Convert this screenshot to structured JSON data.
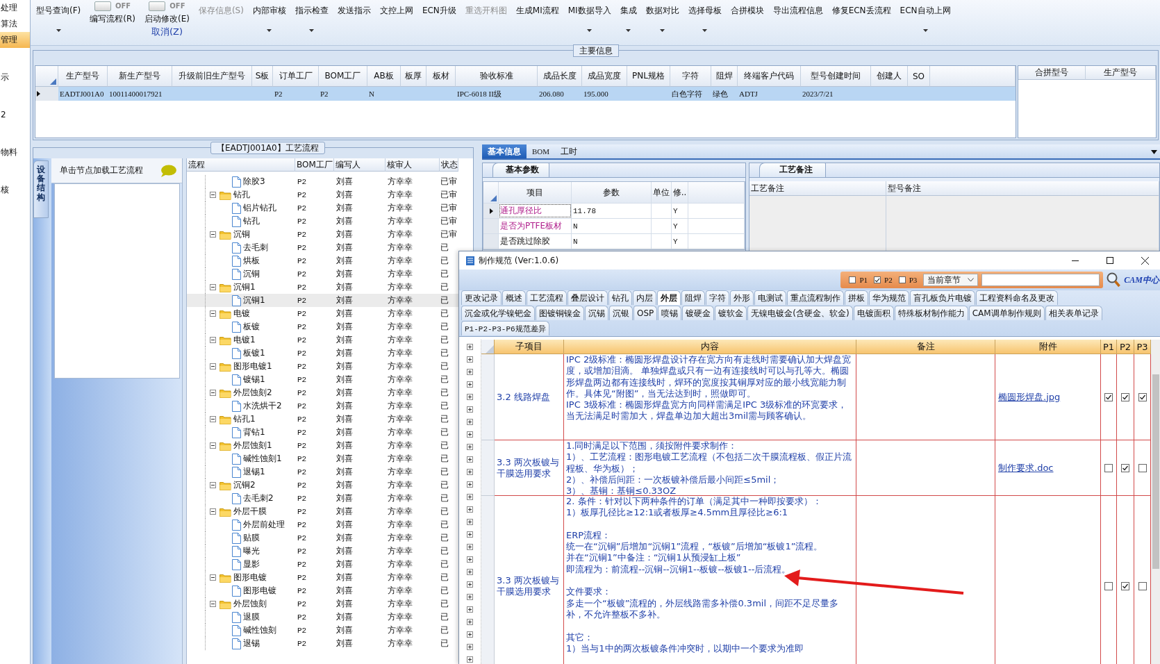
{
  "sidebar": {
    "items": [
      {
        "label": "处理",
        "selected": false
      },
      {
        "label": "算法",
        "selected": false
      },
      {
        "label": "管理",
        "selected": true
      },
      {
        "label": "示",
        "selected": false
      },
      {
        "label": "2",
        "selected": false
      },
      {
        "label": "物料",
        "selected": false
      },
      {
        "label": "核",
        "selected": false
      }
    ]
  },
  "toolbar": {
    "items": [
      {
        "kind": "button",
        "label": "型号查询(F)",
        "dropdown": true,
        "disabled": false
      },
      {
        "kind": "switch",
        "label": "编写流程(R)",
        "switch_text": "OFF",
        "on": false
      },
      {
        "kind": "switch",
        "label": "启动修改(E)",
        "sublabel": "取消(Z)",
        "switch_text": "OFF",
        "on": false
      },
      {
        "kind": "button",
        "label": "保存信息(S)",
        "dropdown": false,
        "disabled": true
      },
      {
        "kind": "button",
        "label": "内部审核",
        "dropdown": true,
        "disabled": false
      },
      {
        "kind": "button",
        "label": "指示检查",
        "dropdown": true,
        "disabled": false
      },
      {
        "kind": "button",
        "label": "发送指示",
        "dropdown": false,
        "disabled": false
      },
      {
        "kind": "button",
        "label": "文控上网",
        "dropdown": false,
        "disabled": false
      },
      {
        "kind": "button",
        "label": "ECN升级",
        "dropdown": false,
        "disabled": false
      },
      {
        "kind": "button",
        "label": "重选开料图",
        "dropdown": false,
        "disabled": true
      },
      {
        "kind": "button",
        "label": "生成MI流程",
        "dropdown": false,
        "disabled": false
      },
      {
        "kind": "button",
        "label": "MI数据导入",
        "dropdown": true,
        "disabled": false
      },
      {
        "kind": "button",
        "label": "集成",
        "dropdown": true,
        "disabled": false
      },
      {
        "kind": "button",
        "label": "数据对比",
        "dropdown": true,
        "disabled": false
      },
      {
        "kind": "button",
        "label": "选择母板",
        "dropdown": true,
        "disabled": false
      },
      {
        "kind": "button",
        "label": "合拼模块",
        "dropdown": false,
        "disabled": false
      },
      {
        "kind": "button",
        "label": "导出流程信息",
        "dropdown": false,
        "disabled": false
      },
      {
        "kind": "button",
        "label": "修复ECN丢流程",
        "dropdown": false,
        "disabled": false
      },
      {
        "kind": "button",
        "label": "ECN自动上网",
        "dropdown": true,
        "disabled": false
      }
    ]
  },
  "main_info": {
    "title": "主要信息",
    "table": {
      "columns": [
        "生产型号",
        "新生产型号",
        "升级前旧生产型号",
        "S板",
        "订单工厂",
        "BOM工厂",
        "AB板",
        "板厚",
        "板材",
        "验收标准",
        "成品长度",
        "成品宽度",
        "PNL规格",
        "字符",
        "阻焊",
        "终端客户代码",
        "型号创建时间",
        "创建人",
        "SO"
      ],
      "rows": [
        {
          "selected": true,
          "cells": [
            "EADTJ001A0",
            "10011400017921",
            null,
            null,
            "P2",
            "P2",
            "N",
            null,
            null,
            "IPC-6018 II级",
            "206.080",
            "195.000",
            null,
            "白色字符",
            "绿色",
            "ADTJ",
            "2023/7/21",
            null,
            null
          ]
        }
      ]
    },
    "merge_table": {
      "columns": [
        "合拼型号",
        "生产型号"
      ]
    }
  },
  "flow": {
    "title": "【EADTJ001A0】工艺流程",
    "side_tab": {
      "label": "设备结构",
      "selected": true
    },
    "hint": "单击节点加载工艺流程",
    "columns": [
      "流程",
      "BOM工厂",
      "编写人",
      "核审人",
      "状态"
    ],
    "rows": [
      {
        "kind": "doc",
        "label": "除胶3",
        "selected": false,
        "bom": "P2",
        "author": "刘喜",
        "reviewer": "方幸幸",
        "status": "已审"
      },
      {
        "kind": "folder",
        "label": "钻孔",
        "expanded": true,
        "selected": false,
        "bom": "P2",
        "author": "刘喜",
        "reviewer": "方幸幸",
        "status": "已审",
        "children": [
          {
            "kind": "doc",
            "label": "铝片钻孔",
            "selected": false,
            "bom": "P2",
            "author": "刘喜",
            "reviewer": "方幸幸",
            "status": "已审"
          },
          {
            "kind": "doc",
            "label": "钻孔",
            "selected": false,
            "bom": "P2",
            "author": "刘喜",
            "reviewer": "方幸幸",
            "status": "已审"
          }
        ]
      },
      {
        "kind": "folder",
        "label": "沉铜",
        "expanded": true,
        "selected": false,
        "bom": "P2",
        "author": "刘喜",
        "reviewer": "方幸幸",
        "status": "已审",
        "children": [
          {
            "kind": "doc",
            "label": "去毛刺",
            "selected": false,
            "bom": "P2",
            "author": "刘喜",
            "reviewer": "方幸幸",
            "status": "已"
          },
          {
            "kind": "doc",
            "label": "烘板",
            "selected": false,
            "bom": "P2",
            "author": "刘喜",
            "reviewer": "方幸幸",
            "status": "已"
          },
          {
            "kind": "doc",
            "label": "沉铜",
            "selected": false,
            "bom": "P2",
            "author": "刘喜",
            "reviewer": "方幸幸",
            "status": "已"
          }
        ]
      },
      {
        "kind": "folder",
        "label": "沉铜1",
        "expanded": true,
        "selected": false,
        "bom": "P2",
        "author": "刘喜",
        "reviewer": "方幸幸",
        "status": "已",
        "children": [
          {
            "kind": "doc",
            "label": "沉铜1",
            "selected": true,
            "bom": "P2",
            "author": "刘喜",
            "reviewer": "方幸幸",
            "status": "已"
          }
        ]
      },
      {
        "kind": "folder",
        "label": "电镀",
        "expanded": true,
        "selected": false,
        "bom": "P2",
        "author": "刘喜",
        "reviewer": "方幸幸",
        "status": "已",
        "children": [
          {
            "kind": "doc",
            "label": "板镀",
            "selected": false,
            "bom": "P2",
            "author": "刘喜",
            "reviewer": "方幸幸",
            "status": "已"
          }
        ]
      },
      {
        "kind": "folder",
        "label": "电镀1",
        "expanded": true,
        "selected": false,
        "bom": "P2",
        "author": "刘喜",
        "reviewer": "方幸幸",
        "status": "已",
        "children": [
          {
            "kind": "doc",
            "label": "板镀1",
            "selected": false,
            "bom": "P2",
            "author": "刘喜",
            "reviewer": "方幸幸",
            "status": "已"
          }
        ]
      },
      {
        "kind": "folder",
        "label": "图形电镀1",
        "expanded": true,
        "selected": false,
        "bom": "P2",
        "author": "刘喜",
        "reviewer": "方幸幸",
        "status": "已",
        "children": [
          {
            "kind": "doc",
            "label": "镀锡1",
            "selected": false,
            "bom": "P2",
            "author": "刘喜",
            "reviewer": "方幸幸",
            "status": "已"
          }
        ]
      },
      {
        "kind": "folder",
        "label": "外层蚀刻2",
        "expanded": true,
        "selected": false,
        "bom": "P2",
        "author": "刘喜",
        "reviewer": "方幸幸",
        "status": "已",
        "children": [
          {
            "kind": "doc",
            "label": "水洗烘干2",
            "selected": false,
            "bom": "P2",
            "author": "刘喜",
            "reviewer": "方幸幸",
            "status": "已"
          }
        ]
      },
      {
        "kind": "folder",
        "label": "钻孔1",
        "expanded": true,
        "selected": false,
        "bom": "P2",
        "author": "刘喜",
        "reviewer": "方幸幸",
        "status": "已",
        "children": [
          {
            "kind": "doc",
            "label": "背钻1",
            "selected": false,
            "bom": "P2",
            "author": "刘喜",
            "reviewer": "方幸幸",
            "status": "已"
          }
        ]
      },
      {
        "kind": "folder",
        "label": "外层蚀刻1",
        "expanded": true,
        "selected": false,
        "bom": "P2",
        "author": "刘喜",
        "reviewer": "方幸幸",
        "status": "已",
        "children": [
          {
            "kind": "doc",
            "label": "碱性蚀刻1",
            "selected": false,
            "bom": "P2",
            "author": "刘喜",
            "reviewer": "方幸幸",
            "status": "已"
          },
          {
            "kind": "doc",
            "label": "退锡1",
            "selected": false,
            "bom": "P2",
            "author": "刘喜",
            "reviewer": "方幸幸",
            "status": "已"
          }
        ]
      },
      {
        "kind": "folder",
        "label": "沉铜2",
        "expanded": true,
        "selected": false,
        "bom": "P2",
        "author": "刘喜",
        "reviewer": "方幸幸",
        "status": "已",
        "children": [
          {
            "kind": "doc",
            "label": "去毛刺2",
            "selected": false,
            "bom": "P2",
            "author": "刘喜",
            "reviewer": "方幸幸",
            "status": "已"
          }
        ]
      },
      {
        "kind": "folder",
        "label": "外层干膜",
        "expanded": true,
        "selected": false,
        "bom": "P2",
        "author": "刘喜",
        "reviewer": "方幸幸",
        "status": "已",
        "children": [
          {
            "kind": "doc",
            "label": "外层前处理",
            "selected": false,
            "bom": "P2",
            "author": "刘喜",
            "reviewer": "方幸幸",
            "status": "已"
          },
          {
            "kind": "doc",
            "label": "贴膜",
            "selected": false,
            "bom": "P2",
            "author": "刘喜",
            "reviewer": "方幸幸",
            "status": "已"
          },
          {
            "kind": "doc",
            "label": "曝光",
            "selected": false,
            "bom": "P2",
            "author": "刘喜",
            "reviewer": "方幸幸",
            "status": "已"
          },
          {
            "kind": "doc",
            "label": "显影",
            "selected": false,
            "bom": "P2",
            "author": "刘喜",
            "reviewer": "方幸幸",
            "status": "已"
          }
        ]
      },
      {
        "kind": "folder",
        "label": "图形电镀",
        "expanded": true,
        "selected": false,
        "bom": "P2",
        "author": "刘喜",
        "reviewer": "方幸幸",
        "status": "已",
        "children": [
          {
            "kind": "doc",
            "label": "图形电镀",
            "selected": false,
            "bom": "P2",
            "author": "刘喜",
            "reviewer": "方幸幸",
            "status": "已"
          }
        ]
      },
      {
        "kind": "folder",
        "label": "外层蚀刻",
        "expanded": true,
        "selected": false,
        "bom": "P2",
        "author": "刘喜",
        "reviewer": "方幸幸",
        "status": "已",
        "children": [
          {
            "kind": "doc",
            "label": "退膜",
            "selected": false,
            "bom": "P2",
            "author": "刘喜",
            "reviewer": "方幸幸",
            "status": "已"
          },
          {
            "kind": "doc",
            "label": "碱性蚀刻",
            "selected": false,
            "bom": "P2",
            "author": "刘喜",
            "reviewer": "方幸幸",
            "status": "已"
          },
          {
            "kind": "doc",
            "label": "退锡",
            "selected": false,
            "bom": "P2",
            "author": "刘喜",
            "reviewer": "方幸幸",
            "status": "已"
          }
        ]
      }
    ]
  },
  "detail": {
    "tabs": [
      {
        "label": "基本信息",
        "selected": true
      },
      {
        "label": "BOM",
        "selected": false
      },
      {
        "label": "工时",
        "selected": false
      }
    ],
    "params": {
      "tab": "基本参数",
      "columns": [
        "项目",
        "参数",
        "单位",
        "修.."
      ],
      "rows": [
        {
          "item": "通孔厚径比",
          "value": "11.78",
          "flag": "Y",
          "highlight": true,
          "selected": true
        },
        {
          "item": "是否为PTFE板材",
          "value": "N",
          "flag": "Y",
          "highlight": true,
          "selected": false
        },
        {
          "item": "是否跳过除胶",
          "value": "N",
          "flag": "Y",
          "highlight": false,
          "selected": false
        }
      ]
    },
    "notes": {
      "tab": "工艺备注",
      "columns": [
        "工艺备注",
        "型号备注"
      ]
    }
  },
  "dialog": {
    "title": "制作规范 (Ver:1.0.6)",
    "filters": [
      {
        "label": "P1",
        "checked": false
      },
      {
        "label": "P2",
        "checked": true
      },
      {
        "label": "P3",
        "checked": false
      }
    ],
    "scope": "当前章节",
    "logo": "CAM中心",
    "tab_rows": [
      [
        {
          "label": "更改记录",
          "selected": false
        },
        {
          "label": "概述",
          "selected": false
        },
        {
          "label": "工艺流程",
          "selected": false
        },
        {
          "label": "叠层设计",
          "selected": false
        },
        {
          "label": "钻孔",
          "selected": false
        },
        {
          "label": "内层",
          "selected": false
        },
        {
          "label": "外层",
          "selected": true
        },
        {
          "label": "阻焊",
          "selected": false
        },
        {
          "label": "字符",
          "selected": false
        },
        {
          "label": "外形",
          "selected": false
        },
        {
          "label": "电测试",
          "selected": false
        },
        {
          "label": "重点流程制作",
          "selected": false
        },
        {
          "label": "拼板",
          "selected": false
        },
        {
          "label": "华为规范",
          "selected": false
        },
        {
          "label": "盲孔板负片电镀",
          "selected": false
        },
        {
          "label": "工程资料命名及更改",
          "selected": false
        }
      ],
      [
        {
          "label": "沉金或化学镍钯金",
          "selected": false
        },
        {
          "label": "图镀铜镍金",
          "selected": false
        },
        {
          "label": "沉锡",
          "selected": false
        },
        {
          "label": "沉银",
          "selected": false
        },
        {
          "label": "OSP",
          "selected": false
        },
        {
          "label": "喷锡",
          "selected": false
        },
        {
          "label": "镀硬金",
          "selected": false
        },
        {
          "label": "镀软金",
          "selected": false
        },
        {
          "label": "无镍电镀金(含硬金、软金)",
          "selected": false
        },
        {
          "label": "电镀面积",
          "selected": false
        },
        {
          "label": "特殊板材制作能力",
          "selected": false
        },
        {
          "label": "CAM调单制作规则",
          "selected": false
        },
        {
          "label": "相关表单记录",
          "selected": false
        }
      ],
      [
        {
          "label": "P1-P2-P3-P6规范差异",
          "selected": false
        }
      ]
    ],
    "table": {
      "columns": [
        "子项目",
        "内容",
        "备注",
        "附件",
        "P1",
        "P2",
        "P3"
      ],
      "rows": [
        {
          "subitem": "3.2 线路焊盘",
          "content": [
            {
              "text": "IPC 2级标准：椭圆形焊盘设计存在宽方向有走线时需要确认加大焊盘宽度，或增加泪滴。 单独焊盘或只有一边有连接线时可以与孔等大。椭圆形焊盘两边都有连接线时，焊环的宽度按其铜厚对应的最小线宽能力制作。具体见“附图”，当无法达到时，照做即可。",
              "spaced": false
            },
            {
              "text": "IPC 3级标准：椭圆形焊盘宽方向同样需满足IPC 3级标准的环宽要求，当无法满足时需加大，焊盘单边加大超出3mil需与顾客确认。",
              "spaced": false
            }
          ],
          "attachment": "椭圆形焊盘.jpg",
          "checks": [
            true,
            true,
            true
          ]
        },
        {
          "subitem": "3.3 两次板镀与干膜选用要求",
          "content": [
            {
              "text": "1.同时满足以下范围，须按附件要求制作：",
              "spaced": false
            },
            {
              "text": "1）、工艺流程：图形电镀工艺流程（不包括二次干膜流程板、假正片流程板、华为板）；",
              "spaced": false
            },
            {
              "text": "2）、补偿后间距：一次板镀补偿后最小间距≤5mil；",
              "spaced": false
            },
            {
              "text": "3）、基铜：基铜≤0.33OZ",
              "spaced": false
            }
          ],
          "attachment": "制作要求.doc",
          "checks": [
            false,
            true,
            false
          ]
        },
        {
          "subitem": "3.3 两次板镀与干膜选用要求",
          "content": [
            {
              "text": "2. 条件：针对以下两种条件的订单（满足其中一种即按要求）：",
              "spaced": false
            },
            {
              "text": "1）板厚孔径比≥12:1或者板厚≥4.5mm且厚径比≥6:1",
              "spaced": false
            },
            {
              "text": "ERP流程：",
              "spaced": true
            },
            {
              "text": "统一在“沉铜”后增加“沉铜1”流程，“板镀”后增加“板镀1”流程。",
              "spaced": false
            },
            {
              "text": "并在“沉铜1”中备注：“沉铜1从预浸缸上板”",
              "spaced": false
            },
            {
              "text": "即流程为：前流程--沉铜--沉铜1--板镀--板镀1--后流程。",
              "spaced": false
            },
            {
              "text": "文件要求：",
              "spaced": true
            },
            {
              "text": "多走一个“板镀”流程的，外层线路需多补偿0.3mil，间距不足尽量多补，不允许整板不多补。",
              "spaced": false
            },
            {
              "text": "其它：",
              "spaced": true
            },
            {
              "text": "1）当与1中的两次板镀条件冲突时，以期中一个要求为准即",
              "spaced": false
            }
          ],
          "checks": [
            false,
            true,
            false
          ]
        }
      ]
    }
  }
}
